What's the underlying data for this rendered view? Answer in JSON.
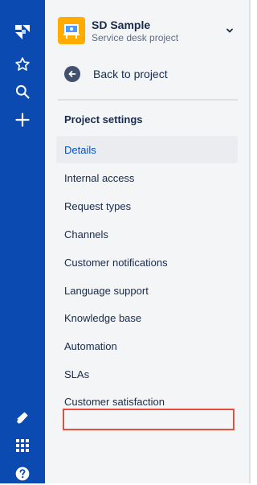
{
  "global_nav": {
    "icons": [
      "jira-logo-icon",
      "star-icon",
      "search-icon",
      "plus-icon",
      "megaphone-icon",
      "app-switcher-icon",
      "help-icon"
    ]
  },
  "project": {
    "name": "SD Sample",
    "type": "Service desk project"
  },
  "back_link": "Back to project",
  "settings": {
    "title": "Project settings",
    "items": [
      {
        "label": "Details",
        "selected": true
      },
      {
        "label": "Internal access"
      },
      {
        "label": "Request types"
      },
      {
        "label": "Channels"
      },
      {
        "label": "Customer notifications"
      },
      {
        "label": "Language support"
      },
      {
        "label": "Knowledge base"
      },
      {
        "label": "Automation"
      },
      {
        "label": "SLAs"
      },
      {
        "label": "Customer satisfaction"
      }
    ]
  },
  "colors": {
    "nav_bg": "#0b4ab0",
    "sidebar_bg": "#f4f5f7",
    "selected_text": "#0052cc",
    "highlight": "#e74c3c"
  }
}
